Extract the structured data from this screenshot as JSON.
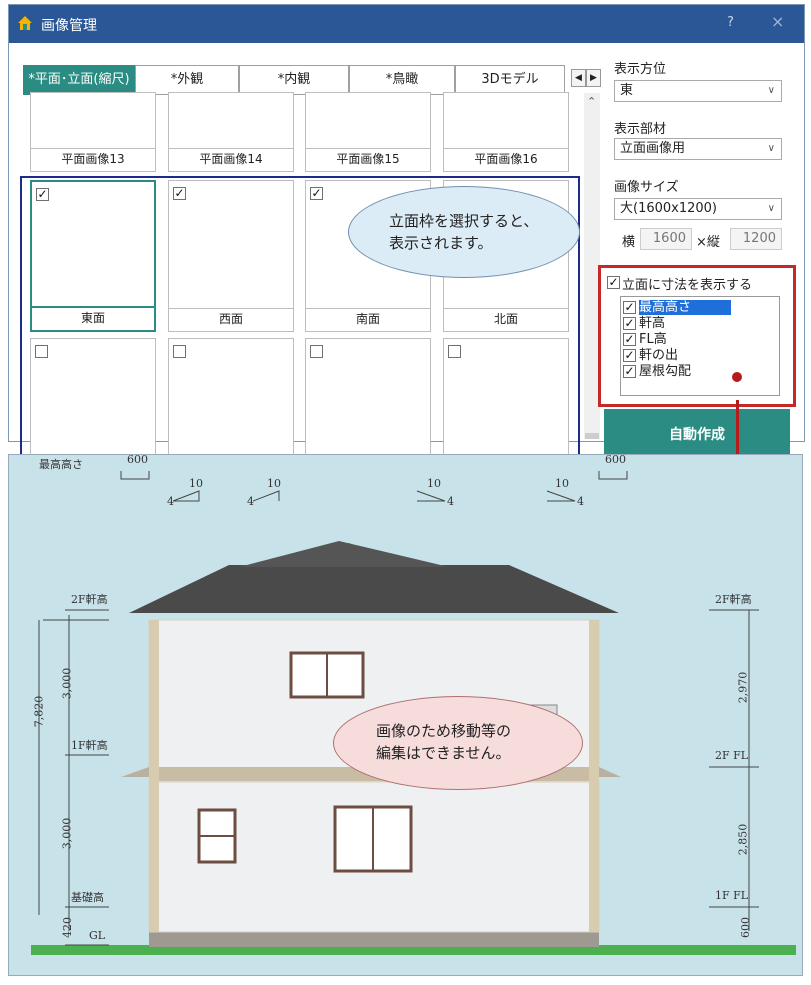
{
  "window": {
    "title": "画像管理",
    "help": "?",
    "close": "×",
    "accent": "#2a8c82",
    "titlebar_color": "#2b5797"
  },
  "tabs": [
    "*平面･立面(縮尺)",
    "*外観",
    "*内観",
    "*鳥瞰",
    "3Dモデル"
  ],
  "tab_nav": {
    "left": "◀",
    "right": "▶"
  },
  "grid": {
    "top_row": [
      "平面画像13",
      "平面画像14",
      "平面画像15",
      "平面画像16"
    ],
    "elevation_row": [
      {
        "label": "東面",
        "checked": true
      },
      {
        "label": "西面",
        "checked": true
      },
      {
        "label": "南面",
        "checked": true
      },
      {
        "label": "北面",
        "checked": true
      }
    ],
    "scroll_up": "⌃"
  },
  "right_panel": {
    "direction_label": "表示方位",
    "direction_value": "東",
    "part_label": "表示部材",
    "part_value": "立面画像用",
    "size_label": "画像サイズ",
    "size_value": "大(1600x1200)",
    "width_label": "横",
    "width_value": "1600",
    "height_label": "×縦",
    "height_value": "1200",
    "dims_checkbox_label": "立面に寸法を表示する",
    "dims_items": [
      "最高高さ",
      "軒高",
      "FL高",
      "軒の出",
      "屋根勾配"
    ],
    "auto_button": "自動作成"
  },
  "callouts": {
    "top_line1": "立面枠を選択すると、",
    "top_line2": "表示されます。",
    "bottom_line1": "画像のため移動等の",
    "bottom_line2": "編集はできません。"
  },
  "elevation": {
    "max_height": "最高高さ",
    "eave_2f_left": "2F軒高",
    "eave_2f_right": "2F軒高",
    "eave_1f": "1F軒高",
    "fl_2f": "2F FL",
    "foundation": "基礎高",
    "fl_1f": "1F FL",
    "gl": "GL",
    "d600a": "600",
    "d600b": "600",
    "slope": "10",
    "slope_base": "4",
    "total": "7,820",
    "h3000a": "3,000",
    "h3000b": "3,000",
    "h420": "420",
    "h2970": "2,970",
    "h2850": "2,850",
    "h600": "600"
  }
}
